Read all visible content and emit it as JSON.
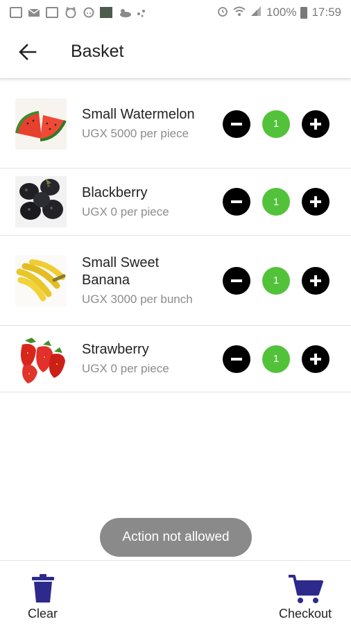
{
  "status_bar": {
    "battery": "100%",
    "time": "17:59",
    "left_icons": [
      "image-icon",
      "mail-icon",
      "calendar-icon",
      "cat-icon",
      "pig-icon",
      "app-icon",
      "weather-icon",
      "dots-icon"
    ],
    "right_icons": [
      "alarm-icon",
      "wifi-icon",
      "signal-icon",
      "battery-icon"
    ]
  },
  "app_bar": {
    "title": "Basket",
    "back_icon": "arrow-left-icon"
  },
  "items": [
    {
      "name": "Small Watermelon",
      "price": "UGX 5000 per piece",
      "quantity": "1",
      "image": "watermelon"
    },
    {
      "name": "Blackberry",
      "price": "UGX 0 per piece",
      "quantity": "1",
      "image": "blackberry"
    },
    {
      "name": "Small Sweet Banana",
      "price": "UGX 3000 per bunch",
      "quantity": "1",
      "image": "banana"
    },
    {
      "name": "Strawberry",
      "price": "UGX 0 per piece",
      "quantity": "1",
      "image": "strawberry"
    }
  ],
  "toast": {
    "message": "Action not allowed"
  },
  "bottom_bar": {
    "clear_label": "Clear",
    "checkout_label": "Checkout"
  },
  "colors": {
    "accent": "#2d2a8c",
    "quantity_badge": "#52c23a",
    "toast_bg": "#8a8a8a"
  }
}
